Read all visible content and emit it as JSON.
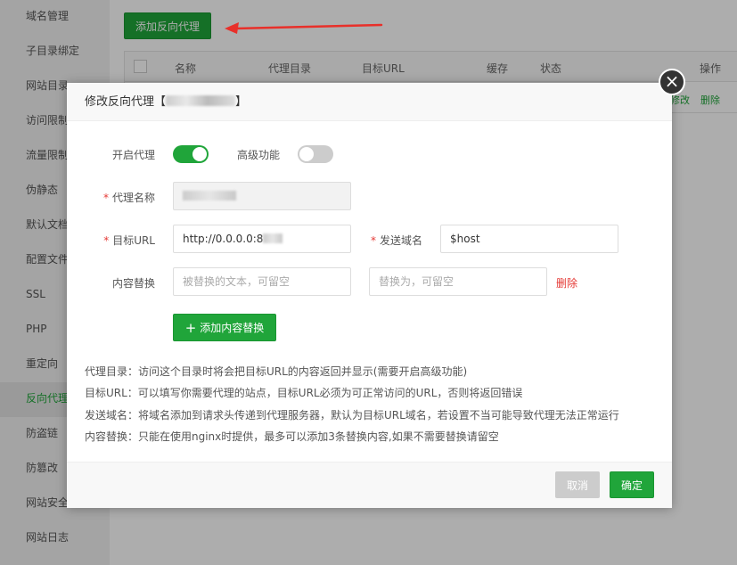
{
  "sidebar": {
    "items": [
      {
        "label": "域名管理",
        "active": false
      },
      {
        "label": "子目录绑定",
        "active": false
      },
      {
        "label": "网站目录",
        "active": false
      },
      {
        "label": "访问限制",
        "active": false
      },
      {
        "label": "流量限制",
        "active": false
      },
      {
        "label": "伪静态",
        "active": false
      },
      {
        "label": "默认文档",
        "active": false
      },
      {
        "label": "配置文件",
        "active": false
      },
      {
        "label": "SSL",
        "active": false
      },
      {
        "label": "PHP",
        "active": false
      },
      {
        "label": "重定向",
        "active": false
      },
      {
        "label": "反向代理",
        "active": true
      },
      {
        "label": "防盗链",
        "active": false
      },
      {
        "label": "防篡改",
        "active": false
      },
      {
        "label": "网站安全",
        "active": false
      },
      {
        "label": "网站日志",
        "active": false
      }
    ]
  },
  "main": {
    "add_button": "添加反向代理",
    "table": {
      "headers": [
        "名称",
        "代理目录",
        "目标URL",
        "缓存",
        "状态",
        "操作"
      ],
      "row_actions": [
        "修改",
        "删除"
      ]
    }
  },
  "modal": {
    "title": "修改反向代理【",
    "title_end": "】",
    "enable_label": "开启代理",
    "enable_on": true,
    "advanced_label": "高级功能",
    "advanced_on": false,
    "name_label": "代理名称",
    "target_label": "目标URL",
    "target_value": "http://0.0.0.0:8",
    "host_label": "发送域名",
    "host_value": "$host",
    "replace_label": "内容替换",
    "replace_placeholder": "被替换的文本，可留空",
    "replace_with_placeholder": "替换为，可留空",
    "delete_label": "删除",
    "add_replace_label": "添加内容替换",
    "help": [
      "代理目录：访问这个目录时将会把目标URL的内容返回并显示(需要开启高级功能)",
      "目标URL：可以填写你需要代理的站点，目标URL必须为可正常访问的URL，否则将返回错误",
      "发送域名：将域名添加到请求头传递到代理服务器，默认为目标URL域名，若设置不当可能导致代理无法正常运行",
      "内容替换：只能在使用nginx时提供，最多可以添加3条替换内容,如果不需要替换请留空"
    ],
    "cancel_label": "取消",
    "ok_label": "确定"
  },
  "colors": {
    "accent": "#20a53a",
    "danger": "#e53935"
  }
}
